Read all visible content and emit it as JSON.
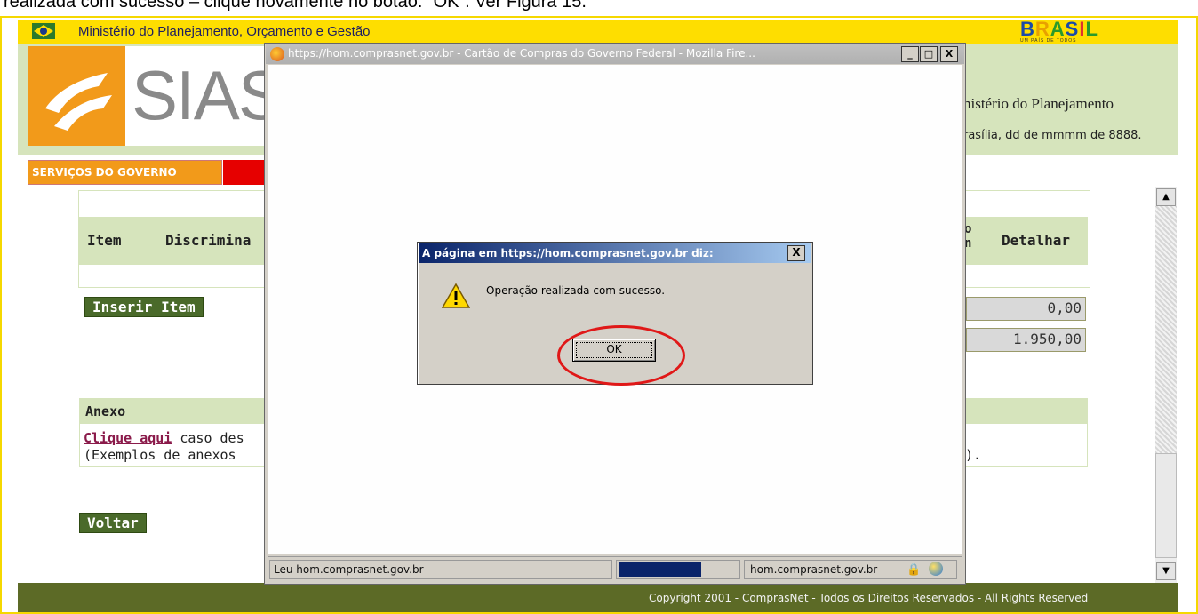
{
  "caption": "realizada com sucesso – clique novamente no botão: “OK”. Ver Figura 15.",
  "gov_bar": {
    "title": "Ministério do Planejamento, Orçamento e Gestão",
    "brasil_logo": "BRASIL",
    "brasil_subtitle": "UM PAÍS DE TODOS"
  },
  "header": {
    "logo_text": "SIAS",
    "ministerio": "nistério do Planejamento",
    "date": "rasília, dd de mmmm de 8888."
  },
  "menu": {
    "servicos": "SERVIÇOS DO GOVERNO"
  },
  "table": {
    "col_item": "Item",
    "col_discriminacao": "Discrimina",
    "col_partial": "o\nn",
    "col_detalhar": "Detalhar"
  },
  "buttons": {
    "inserir": "Inserir Item",
    "voltar": "Voltar"
  },
  "values": {
    "v1": "0,00",
    "v2": "1.950,00"
  },
  "anexo": {
    "title": "Anexo",
    "link": "Clique aqui",
    "line1_rest": " caso des",
    "line2": "(Exemplos de anexos",
    "line2_end": ")."
  },
  "footer": {
    "text": "Copyright 2001 - ComprasNet - Todos os Direitos Reservados - All Rights Reserved"
  },
  "popup": {
    "title": "https://hom.comprasnet.gov.br - Cartão de Compras do Governo Federal - Mozilla Fire...",
    "status_text": "Leu hom.comprasnet.gov.br",
    "status_host": "hom.comprasnet.gov.br",
    "progress": 0.7,
    "min_label": "_",
    "max_label": "□",
    "close_label": "X"
  },
  "alert": {
    "title": "A página em https://hom.comprasnet.gov.br diz:",
    "message": "Operação realizada com sucesso.",
    "ok_label": "OK",
    "close_label": "X"
  },
  "colors": {
    "gov_yellow": "#fede00",
    "header_green": "#d6e4bc",
    "orange": "#f29a1a",
    "red": "#e60000",
    "footer_olive": "#5c6a26",
    "button_green": "#4a6a2a",
    "highlight_red": "#e01818"
  }
}
